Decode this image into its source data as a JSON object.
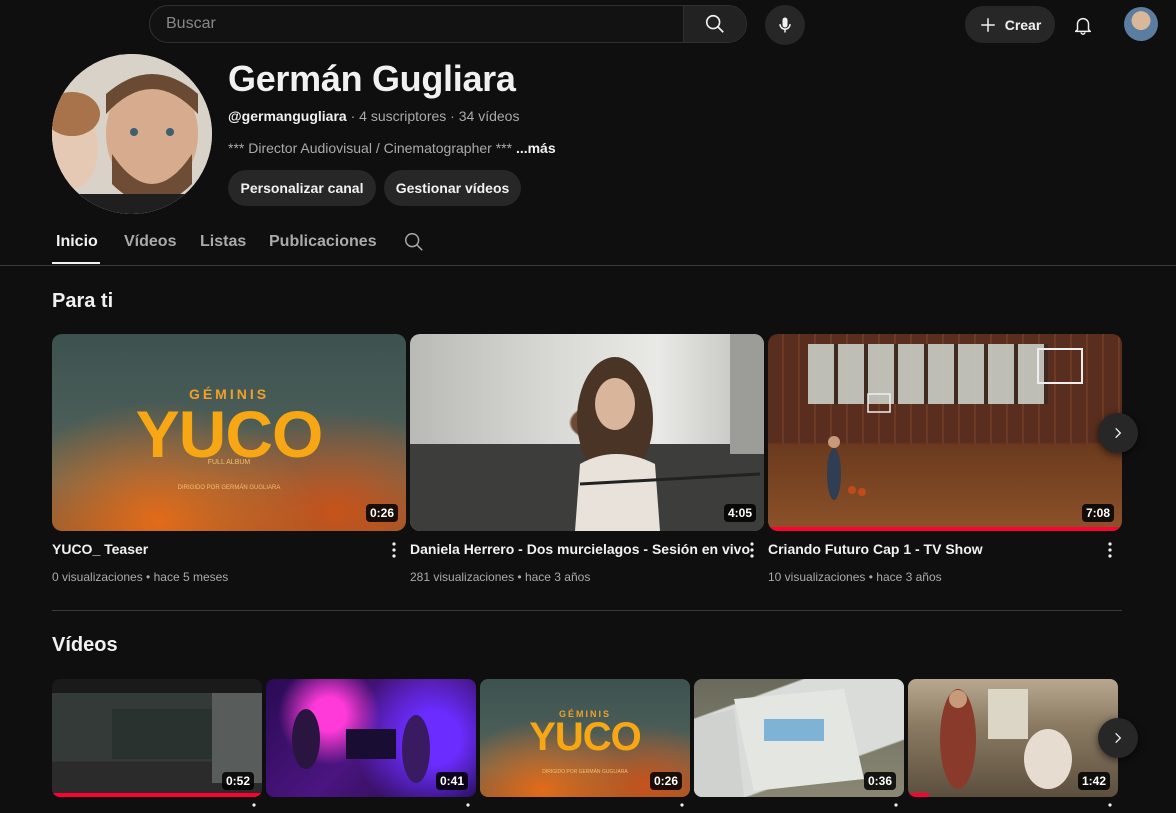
{
  "header": {
    "search_placeholder": "Buscar",
    "create_label": "Crear"
  },
  "channel": {
    "name": "Germán Gugliara",
    "handle": "@germangugliara",
    "subscribers": "4 suscriptores",
    "videos_count": "34 vídeos",
    "separator": " · ",
    "description": "*** Director Audiovisual / Cinematographer ***",
    "more_label": "...más",
    "customize_label": "Personalizar canal",
    "manage_label": "Gestionar vídeos"
  },
  "tabs": [
    {
      "label": "Inicio",
      "active": true
    },
    {
      "label": "Vídeos",
      "active": false
    },
    {
      "label": "Listas",
      "active": false
    },
    {
      "label": "Publicaciones",
      "active": false
    }
  ],
  "for_you": {
    "title": "Para ti",
    "videos": [
      {
        "title": "YUCO_ Teaser",
        "views": "0 visualizaciones",
        "age": "hace 5 meses",
        "duration": "0:26",
        "progress": 0
      },
      {
        "title": "Daniela Herrero - Dos murcielagos - Sesión en vivo",
        "views": "281 visualizaciones",
        "age": "hace 3 años",
        "duration": "4:05",
        "progress": 0
      },
      {
        "title": "Criando Futuro Cap 1 - TV Show",
        "views": "10 visualizaciones",
        "age": "hace 3 años",
        "duration": "7:08",
        "progress": 1
      }
    ]
  },
  "yuco_art": {
    "brand": "GÉMINIS",
    "title": "YUCO",
    "subtitle": "FULL ALBUM",
    "credit": "DIRIGIDO POR GERMÁN GUGLIARA"
  },
  "videos_section": {
    "title": "Vídeos",
    "videos": [
      {
        "duration": "0:52",
        "progress": 1
      },
      {
        "duration": "0:41",
        "progress": 0
      },
      {
        "duration": "0:26",
        "progress": 0
      },
      {
        "duration": "0:36",
        "progress": 0
      },
      {
        "duration": "1:42",
        "progress": 0.1
      }
    ]
  },
  "meta_separator": " • ",
  "colors": {
    "background": "#0f0f0f",
    "accent_red": "#ff0033",
    "pill": "#272727"
  }
}
